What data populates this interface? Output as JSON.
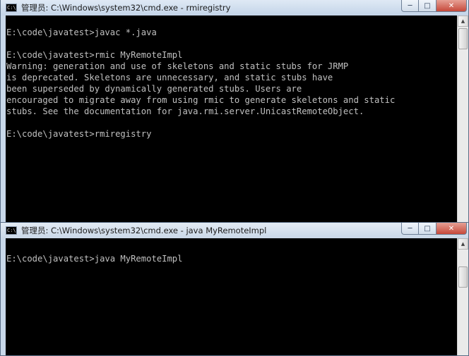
{
  "window1": {
    "icon_text": "C:\\",
    "title": "管理员: C:\\Windows\\system32\\cmd.exe - rmiregistry",
    "controls": {
      "minimize": "─",
      "maximize": "□",
      "close": "✕"
    },
    "console_lines": [
      "",
      "E:\\code\\javatest>javac *.java",
      "",
      "E:\\code\\javatest>rmic MyRemoteImpl",
      "Warning: generation and use of skeletons and static stubs for JRMP",
      "is deprecated. Skeletons are unnecessary, and static stubs have",
      "been superseded by dynamically generated stubs. Users are",
      "encouraged to migrate away from using rmic to generate skeletons and static",
      "stubs. See the documentation for java.rmi.server.UnicastRemoteObject.",
      "",
      "E:\\code\\javatest>rmiregistry"
    ],
    "scroll_up_arrow": "▲"
  },
  "window2": {
    "icon_text": "C:\\",
    "title": "管理员: C:\\Windows\\system32\\cmd.exe - java  MyRemoteImpl",
    "controls": {
      "minimize": "─",
      "maximize": "□",
      "close": "✕"
    },
    "console_lines": [
      "",
      "E:\\code\\javatest>java MyRemoteImpl"
    ],
    "scroll_up_arrow": "▲"
  }
}
